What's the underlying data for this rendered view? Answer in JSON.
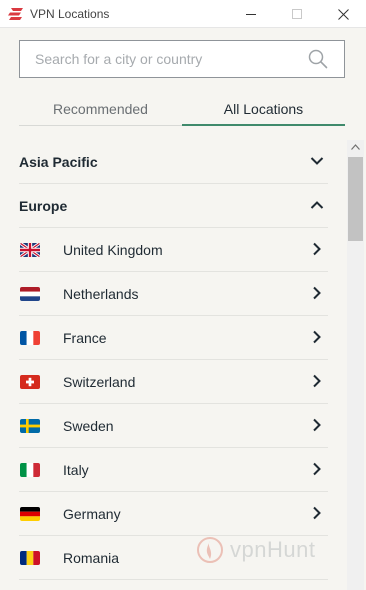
{
  "window": {
    "title": "VPN Locations",
    "accent": "#da3940"
  },
  "search": {
    "placeholder": "Search for a city or country",
    "value": "",
    "icon": "search-icon"
  },
  "tabs": [
    {
      "label": "Recommended",
      "active": false
    },
    {
      "label": "All Locations",
      "active": true
    }
  ],
  "colors": {
    "tab_active_underline": "#3f8a6c",
    "background": "#f6f5f1"
  },
  "sections": [
    {
      "label": "Asia Pacific",
      "expanded": false
    },
    {
      "label": "Europe",
      "expanded": true,
      "countries": [
        {
          "label": "United Kingdom",
          "flag": "uk"
        },
        {
          "label": "Netherlands",
          "flag": "nl"
        },
        {
          "label": "France",
          "flag": "fr"
        },
        {
          "label": "Switzerland",
          "flag": "ch"
        },
        {
          "label": "Sweden",
          "flag": "se"
        },
        {
          "label": "Italy",
          "flag": "it"
        },
        {
          "label": "Germany",
          "flag": "de"
        },
        {
          "label": "Romania",
          "flag": "ro"
        }
      ]
    }
  ],
  "watermark": {
    "text": "vpnHunt"
  }
}
